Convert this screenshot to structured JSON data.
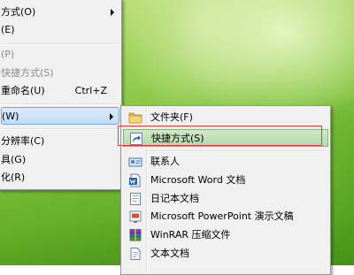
{
  "context_menu": {
    "items": [
      {
        "label": "方式(O)",
        "has_submenu": true
      },
      {
        "label": "(E)"
      },
      {
        "label": "(P)",
        "disabled": true
      },
      {
        "label": "快捷方式(S)",
        "disabled": true
      },
      {
        "label": "重命名(U)",
        "shortcut": "Ctrl+Z",
        "icon": "undo-icon"
      },
      {
        "label": "(W)",
        "has_submenu": true,
        "highlighted": true
      },
      {
        "label": "分辨率(C)",
        "icon": "display-icon"
      },
      {
        "label": "具(G)"
      },
      {
        "label": "化(R)"
      }
    ]
  },
  "new_submenu": {
    "items": [
      {
        "label": "文件夹(F)",
        "icon": "folder-icon"
      },
      {
        "label": "快捷方式(S)",
        "icon": "shortcut-icon",
        "highlighted": true
      },
      {
        "label": "联系人",
        "icon": "contact-icon"
      },
      {
        "label": "Microsoft Word 文档",
        "icon": "word-document-icon"
      },
      {
        "label": "日记本文档",
        "icon": "journal-document-icon"
      },
      {
        "label": "Microsoft PowerPoint 演示文稿",
        "icon": "powerpoint-document-icon"
      },
      {
        "label": "WinRAR 压缩文件",
        "icon": "winrar-archive-icon"
      },
      {
        "label": "文本文档",
        "icon": "text-document-icon"
      }
    ]
  },
  "colors": {
    "menu_background": "#f0f0f0",
    "hover_highlight": "#c1dcf7",
    "selected_highlight": "#b5d9ab",
    "callout_border": "#e0393b",
    "disabled_text": "#8d8d8d"
  }
}
